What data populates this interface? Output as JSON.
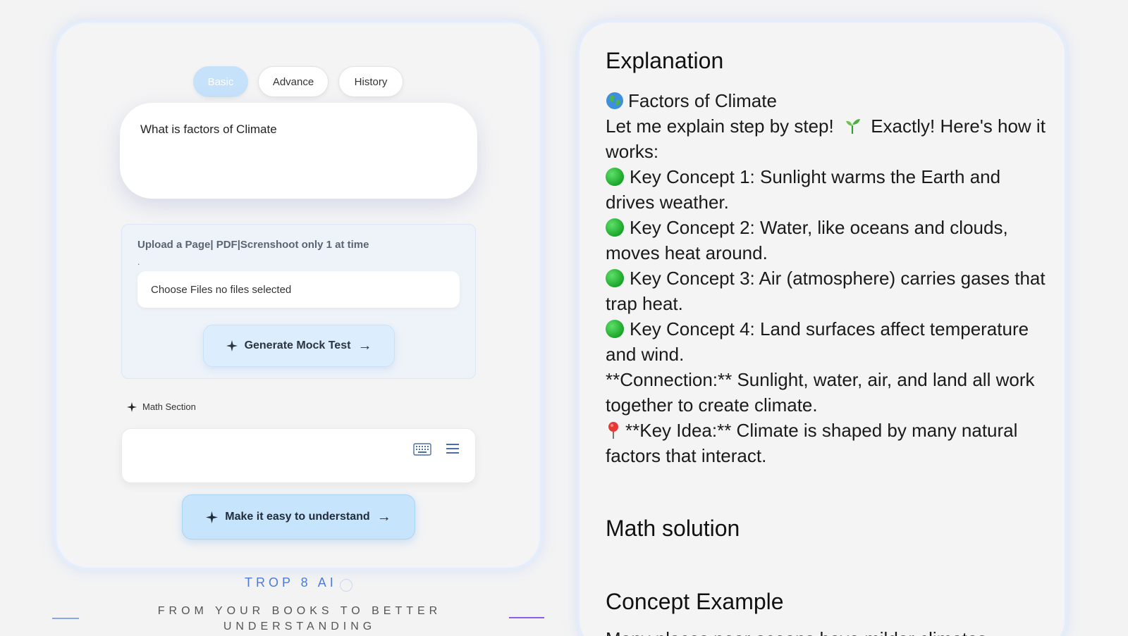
{
  "tabs": [
    {
      "label": "Basic",
      "active": true
    },
    {
      "label": "Advance",
      "active": false
    },
    {
      "label": "History",
      "active": false
    }
  ],
  "question": {
    "value": "What is factors of Climate"
  },
  "upload": {
    "title": "Upload a Page| PDF|Screnshoot only 1 at time",
    "dot": ".",
    "file_label": "Choose Files no files selected",
    "generate_button": "Generate Mock Test"
  },
  "math": {
    "section_label": "Math Section",
    "input_value": ""
  },
  "easy_button": "Make it easy to understand",
  "arrow": "→",
  "brand": {
    "name": "TROP 8 AI",
    "tagline": "FROM YOUR BOOKS TO BETTER UNDERSTANDING"
  },
  "explanation": {
    "title": "Explanation",
    "heading": "Factors of Climate",
    "intro_a": "Let me explain step by step!",
    "intro_b": "Exactly! Here's how it works:",
    "concepts": [
      "Key Concept 1: Sunlight warms the Earth and drives weather.",
      "Key Concept 2: Water, like oceans and clouds, moves heat around.",
      "Key Concept 3: Air (atmosphere) carries gases that trap heat.",
      "Key Concept 4: Land surfaces affect temperature and wind."
    ],
    "connection": "**Connection:** Sunlight, water, air, and land all work together to create climate.",
    "key_idea": "**Key Idea:** Climate is shaped by many natural factors that interact."
  },
  "math_solution_title": "Math solution",
  "concept_example_title": "Concept Example",
  "concept_example_partial": "Many places near oceans have milder climates..."
}
